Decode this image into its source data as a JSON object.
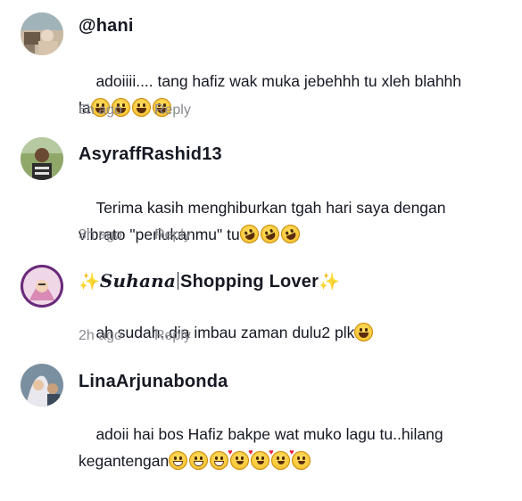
{
  "comments": [
    {
      "username": "@hani",
      "text_parts": [
        "adoiiii.... tang hafiz wak muka jebehhh tu xleh blahhh",
        "la"
      ],
      "emojis": [
        "laughing",
        "laughing",
        "laughing",
        "laughing"
      ],
      "time": "6h ago",
      "reply": "Reply"
    },
    {
      "username": "AsyraffRashid13",
      "text_parts": [
        "Terima kasih menghiburkan tgah hari saya dengan",
        "vibrato \"perlukanmu\" tu"
      ],
      "emojis": [
        "rofl",
        "rofl",
        "rofl"
      ],
      "time": "3h ago",
      "reply": "Reply"
    },
    {
      "username_fancy": "Suhana",
      "username_plain": "Shopping Lover",
      "sparkle": "✨",
      "text_parts": [
        "ah sudah..dia imbau zaman dulu2 plk"
      ],
      "emojis": [
        "laughing"
      ],
      "time": "2h ago",
      "reply": "Reply"
    },
    {
      "username": "LinaArjunabonda",
      "text_parts": [
        "adoii hai bos Hafiz bakpe wat muko lagu tu..hilang",
        "kegantengan"
      ],
      "emojis": [
        "grinning",
        "grinning",
        "grinning",
        "smiling-hearts",
        "smiling-hearts",
        "smiling-hearts",
        "smiling-hearts"
      ],
      "time": "",
      "reply": ""
    }
  ]
}
